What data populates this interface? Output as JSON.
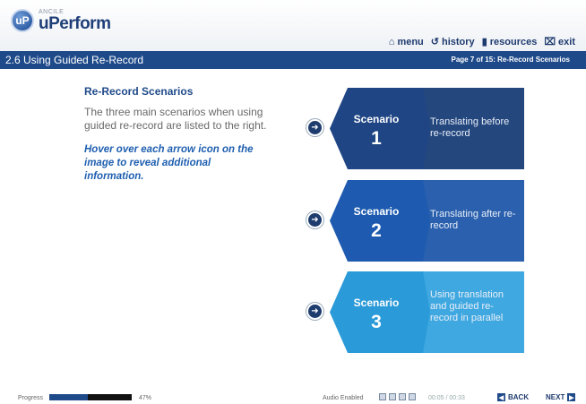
{
  "app": {
    "brand_small": "ANCILE",
    "brand_name": "uPerform",
    "brand_letter": "uP"
  },
  "nav": {
    "menu": "menu",
    "history": "history",
    "resources": "resources",
    "exit": "exit"
  },
  "titlebar": {
    "section": "2.6 Using Guided Re-Record",
    "page_info": "Page 7 of 15: Re-Record Scenarios"
  },
  "content": {
    "heading": "Re-Record Scenarios",
    "body": "The three main scenarios when using guided re-record are listed to the right.",
    "hint": "Hover over each arrow icon on the image to reveal additional information."
  },
  "scenarios": [
    {
      "word": "Scenario",
      "number": "1",
      "description": "Translating before re-record",
      "color_left": "#1f4584",
      "color_right": "#24477e"
    },
    {
      "word": "Scenario",
      "number": "2",
      "description": "Translating after re-record",
      "color_left": "#1e5bb0",
      "color_right": "#2a60ad"
    },
    {
      "word": "Scenario",
      "number": "3",
      "description": "Using translation and guided re-record in parallel",
      "color_left": "#2a9ad8",
      "color_right": "#3fa8e0"
    }
  ],
  "footer": {
    "progress_label": "Progress",
    "progress_value": 0.47,
    "progress_text": "47%",
    "audio_label": "Audio Enabled",
    "audio_time": "00:05 / 00:33",
    "back": "BACK",
    "next": "NEXT"
  },
  "colors": {
    "accent": "#1f4a8a"
  }
}
